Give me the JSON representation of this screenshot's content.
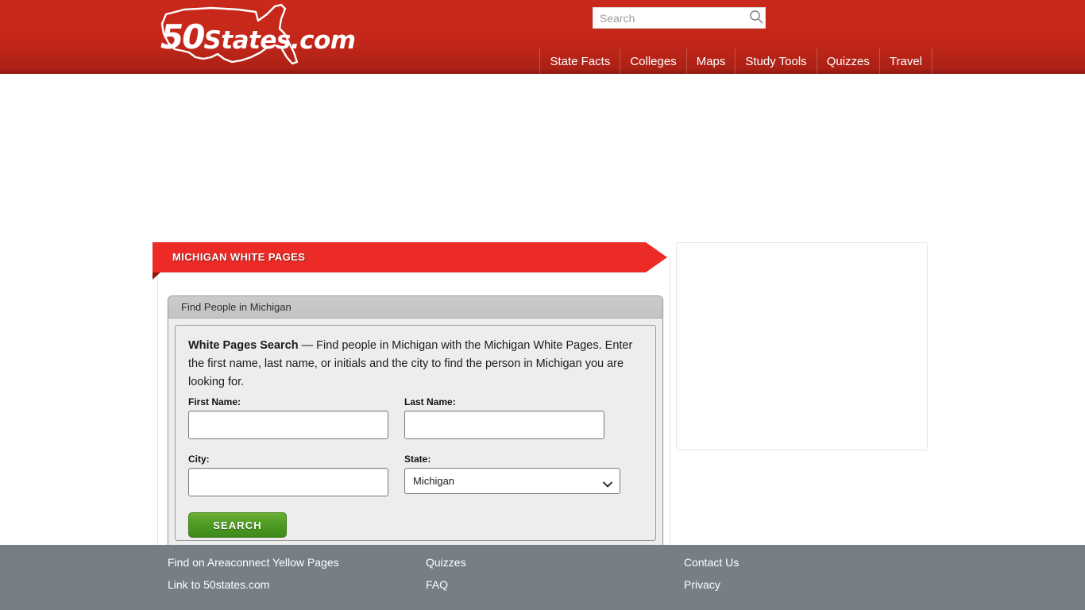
{
  "header": {
    "logo": {
      "icon": "us-map-outline-icon",
      "number": "50",
      "word": "States.com"
    },
    "search": {
      "placeholder": "Search",
      "value": "",
      "icon": "search-icon"
    },
    "nav": [
      {
        "label": "State Facts"
      },
      {
        "label": "Colleges"
      },
      {
        "label": "Maps"
      },
      {
        "label": "Study Tools"
      },
      {
        "label": "Quizzes"
      },
      {
        "label": "Travel"
      }
    ]
  },
  "main": {
    "ribbon_title": "MICHIGAN WHITE PAGES",
    "panel_title": "Find People in Michigan",
    "blurb_lead": "White Pages Search",
    "blurb_body": " — Find people in Michigan with the Michigan White Pages. Enter the first name, last name, or initials and the city to find the person in Michigan you are looking for.",
    "form": {
      "first_name": {
        "label": "First Name:",
        "value": "",
        "placeholder": ""
      },
      "last_name": {
        "label": "Last Name:",
        "value": "",
        "placeholder": ""
      },
      "city": {
        "label": "City:",
        "value": "",
        "placeholder": ""
      },
      "state": {
        "label": "State:",
        "selected": "Michigan",
        "chevron": "chevron-down-icon"
      },
      "submit_label": "SEARCH"
    }
  },
  "footer": {
    "links": [
      {
        "label": "Find on Areaconnect Yellow Pages"
      },
      {
        "label": "Quizzes"
      },
      {
        "label": "Contact Us"
      },
      {
        "label": "Link to 50states.com"
      },
      {
        "label": "FAQ"
      },
      {
        "label": "Privacy"
      }
    ]
  },
  "colors": {
    "header_red": "#c4271a",
    "ribbon_red": "#ed2b26",
    "ribbon_fold": "#8d1410",
    "button_green": "#4e9a23",
    "footer_gray": "#767f86",
    "panel_gray": "#ededed"
  }
}
